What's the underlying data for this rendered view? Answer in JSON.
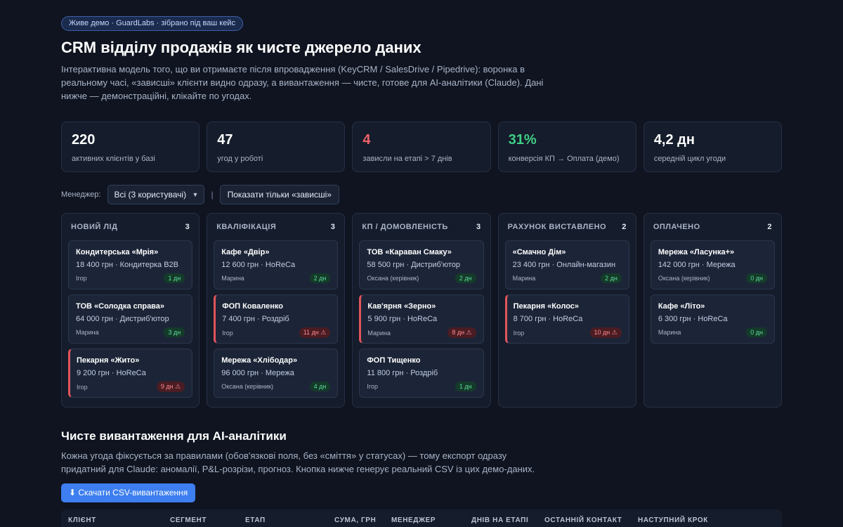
{
  "badge": "Живе демо · GuardLabs · зібрано під ваш кейс",
  "title": "CRM відділу продажів як чисте джерело даних",
  "lead": "Інтерактивна модель того, що ви отримаєте після впровадження (KeyCRM / SalesDrive / Pipedrive): воронка в реальному часі, «зависші» клієнти видно одразу, а вивантаження — чисте, готове для AI-аналітики (Claude). Дані нижче — демонстраційні, клікайте по угодах.",
  "stats": [
    {
      "value": "220",
      "label": "активних клієнтів у базі"
    },
    {
      "value": "47",
      "label": "угод у роботі"
    },
    {
      "value": "4",
      "label": "зависли на етапі > 7 днів",
      "color": "#f0626a"
    },
    {
      "value": "31%",
      "label": "конверсія КП → Оплата (демо)",
      "color": "#3fcf85"
    },
    {
      "value": "4,2 дн",
      "label": "середній цикл угоди"
    }
  ],
  "filters": {
    "manager_label": "Менеджер:",
    "manager_selected": "Всі (3 користувачі)",
    "separator": "|",
    "stuck_button": "Показати тільки «зависші»"
  },
  "board": [
    {
      "title": "НОВИЙ ЛІД",
      "count": "3",
      "cards": [
        {
          "name": "Кондитерська «Мрія»",
          "meta": "18 400 грн · Кондитерка B2B",
          "manager": "Ігор",
          "days": "1 дн",
          "stuck": false
        },
        {
          "name": "ТОВ «Солодка справа»",
          "meta": "64 000 грн · Дистриб'ютор",
          "manager": "Марина",
          "days": "3 дн",
          "stuck": false
        },
        {
          "name": "Пекарня «Жито»",
          "meta": "9 200 грн · HoReCa",
          "manager": "Ігор",
          "days": "9 дн ⚠",
          "stuck": true
        }
      ]
    },
    {
      "title": "КВАЛІФІКАЦІЯ",
      "count": "3",
      "cards": [
        {
          "name": "Кафе «Двір»",
          "meta": "12 600 грн · HoReCa",
          "manager": "Марина",
          "days": "2 дн",
          "stuck": false
        },
        {
          "name": "ФОП Коваленко",
          "meta": "7 400 грн · Роздріб",
          "manager": "Ігор",
          "days": "11 дн ⚠",
          "stuck": true
        },
        {
          "name": "Мережа «Хлібодар»",
          "meta": "96 000 грн · Мережа",
          "manager": "Оксана (керівник)",
          "days": "4 дн",
          "stuck": false
        }
      ]
    },
    {
      "title": "КП / ДОМОВЛЕНІСТЬ",
      "count": "3",
      "cards": [
        {
          "name": "ТОВ «Караван Смаку»",
          "meta": "58 500 грн · Дистриб'ютор",
          "manager": "Оксана (керівник)",
          "days": "2 дн",
          "stuck": false
        },
        {
          "name": "Кав'ярня «Зерно»",
          "meta": "5 900 грн · HoReCa",
          "manager": "Марина",
          "days": "8 дн ⚠",
          "stuck": true
        },
        {
          "name": "ФОП Тищенко",
          "meta": "11 800 грн · Роздріб",
          "manager": "Ігор",
          "days": "1 дн",
          "stuck": false
        }
      ]
    },
    {
      "title": "РАХУНОК ВИСТАВЛЕНО",
      "count": "2",
      "cards": [
        {
          "name": "«Смачно Дім»",
          "meta": "23 400 грн · Онлайн-магазин",
          "manager": "Марина",
          "days": "2 дн",
          "stuck": false
        },
        {
          "name": "Пекарня «Колос»",
          "meta": "8 700 грн · HoReCa",
          "manager": "Ігор",
          "days": "10 дн ⚠",
          "stuck": true
        }
      ]
    },
    {
      "title": "ОПЛАЧЕНО",
      "count": "2",
      "cards": [
        {
          "name": "Мережа «Ласунка+»",
          "meta": "142 000 грн · Мережа",
          "manager": "Оксана (керівник)",
          "days": "0 дн",
          "stuck": false
        },
        {
          "name": "Кафе «Літо»",
          "meta": "6 300 грн · HoReCa",
          "manager": "Марина",
          "days": "0 дн",
          "stuck": false
        }
      ]
    }
  ],
  "export": {
    "title": "Чисте вивантаження для AI-аналітики",
    "text": "Кожна угода фіксується за правилами (обов'язкові поля, без «сміття» у статусах) — тому експорт одразу придатний для Claude: аномалії, P&L-розрізи, прогноз. Кнопка нижче генерує реальний CSV із цих демо-даних.",
    "button": "⬇ Скачати CSV-вивантаження"
  },
  "table": {
    "headers": [
      "КЛІЄНТ",
      "СЕГМЕНТ",
      "ЕТАП",
      "СУМА, ГРН",
      "МЕНЕДЖЕР",
      "ДНІВ НА ЕТАПІ",
      "ОСТАННІЙ КОНТАКТ",
      "НАСТУПНИЙ КРОК"
    ]
  }
}
